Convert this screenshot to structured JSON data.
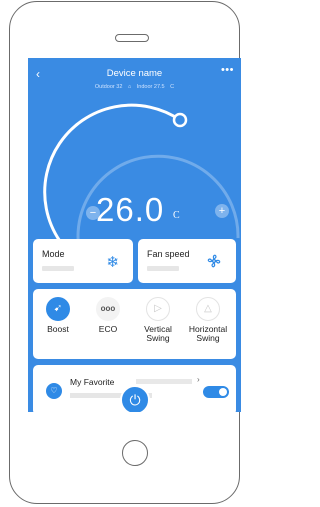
{
  "header": {
    "back_icon": "chevron-left-icon",
    "title": "Device name",
    "more_label": "•••",
    "outdoor": "Outdoor 32",
    "indoor": "Indoor 27.5",
    "indoor_unit": "C"
  },
  "dial": {
    "temperature": "26.0",
    "unit": "C",
    "minus_label": "−",
    "plus_label": "+"
  },
  "mode": {
    "label": "Mode",
    "icon": "snowflake-icon"
  },
  "fan_speed": {
    "label": "Fan speed",
    "icon": "fan-icon"
  },
  "functions": [
    {
      "label": "Boost",
      "icon": "boost-icon",
      "active": true
    },
    {
      "label": "ECO",
      "icon": "eco-icon",
      "active": false
    },
    {
      "label_line1": "Vertical",
      "label_line2": "Swing",
      "icon": "vertical-swing-icon",
      "active": false
    },
    {
      "label_line1": "Horizontal",
      "label_line2": "Swing",
      "icon": "horizontal-swing-icon",
      "active": false
    }
  ],
  "favorite": {
    "title": "My Favorite",
    "chevron": "›",
    "toggle_on": true
  },
  "colors": {
    "screen_bg": "#3a8be3",
    "accent": "#2f8ae6",
    "card_bg": "#ffffff"
  }
}
